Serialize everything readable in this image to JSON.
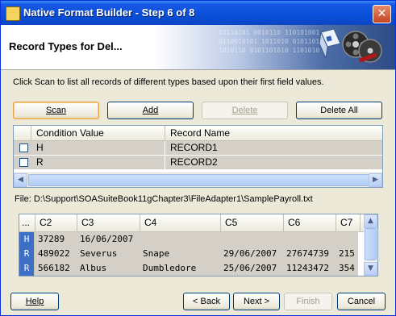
{
  "window": {
    "title": "Native Format Builder - Step 6 of 8",
    "close_glyph": "✕"
  },
  "header": {
    "title": "Record Types for Del..."
  },
  "instructions": "Click Scan to list all records of different types based upon their first field values.",
  "buttons": {
    "scan": "Scan",
    "add": "Add",
    "delete": "Delete",
    "delete_all": "Delete All"
  },
  "record_table": {
    "columns": [
      "Condition Value",
      "Record Name"
    ],
    "rows": [
      {
        "checked": false,
        "condition": "H",
        "record": "RECORD1"
      },
      {
        "checked": false,
        "condition": "R",
        "record": "RECORD2"
      }
    ]
  },
  "file": {
    "label": "File: D:\\Support\\SOASuiteBook11gChapter3\\FileAdapter1\\SamplePayroll.txt"
  },
  "preview_table": {
    "columns": [
      "...",
      "C2",
      "C3",
      "C4",
      "C5",
      "C6",
      "C7"
    ],
    "rows": [
      [
        "H",
        "37289",
        "16/06/2007",
        "",
        "",
        "",
        ""
      ],
      [
        "R",
        "489022",
        "Severus",
        "Snape",
        "29/06/2007",
        "27674739",
        "215"
      ],
      [
        "R",
        "566182",
        "Albus",
        "Dumbledore",
        "25/06/2007",
        "11243472",
        "354"
      ]
    ]
  },
  "footer": {
    "help": "Help",
    "back": "< Back",
    "next": "Next >",
    "finish": "Finish",
    "cancel": "Cancel"
  },
  "banner_bits": "10110101 0010110 110101001\n0110010101 1011010 0101101\n1010110 0101101010 1101010"
}
